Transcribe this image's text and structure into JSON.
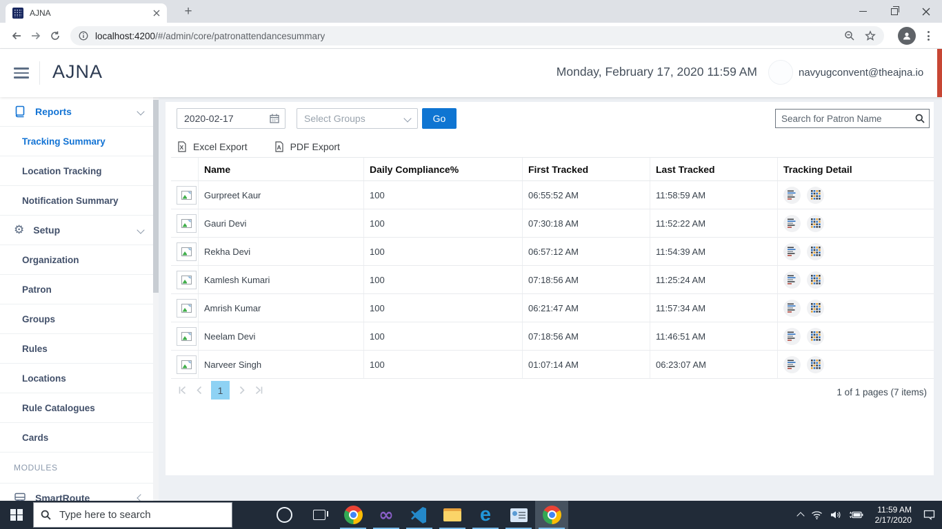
{
  "browser": {
    "tab": {
      "title": "AJNA"
    },
    "url_host": "localhost:4200",
    "url_path": "/#/admin/core/patronattendancesummary"
  },
  "header": {
    "app_title": "AJNA",
    "datetime": "Monday, February 17, 2020 11:59 AM",
    "user_email": "navyugconvent@theajna.io"
  },
  "sidebar": {
    "sections": [
      {
        "label": "Reports",
        "icon": "book-icon",
        "items": [
          "Tracking Summary",
          "Location Tracking",
          "Notification Summary"
        ]
      },
      {
        "label": "Setup",
        "icon": "gear-icon",
        "items": [
          "Organization",
          "Patron",
          "Groups",
          "Rules",
          "Locations",
          "Rule Catalogues",
          "Cards"
        ]
      }
    ],
    "active_item": "Tracking Summary",
    "modules_heading": "MODULES",
    "modules": [
      {
        "label": "SmartRoute",
        "icon": "bus-icon"
      }
    ]
  },
  "toolbar": {
    "date_value": "2020-02-17",
    "groups_placeholder": "Select Groups",
    "go_label": "Go",
    "search_placeholder": "Search for Patron Name"
  },
  "export": {
    "excel_label": "Excel Export",
    "pdf_label": "PDF Export"
  },
  "table": {
    "columns": {
      "name": "Name",
      "compliance": "Daily Compliance%",
      "first": "First Tracked",
      "last": "Last Tracked",
      "detail": "Tracking Detail"
    },
    "rows": [
      {
        "name": "Gurpreet Kaur",
        "compliance": "100",
        "first_tracked": "06:55:52 AM",
        "last_tracked": "11:58:59 AM"
      },
      {
        "name": "Gauri Devi",
        "compliance": "100",
        "first_tracked": "07:30:18 AM",
        "last_tracked": "11:52:22 AM"
      },
      {
        "name": "Rekha Devi",
        "compliance": "100",
        "first_tracked": "06:57:12 AM",
        "last_tracked": "11:54:39 AM"
      },
      {
        "name": "Kamlesh Kumari",
        "compliance": "100",
        "first_tracked": "07:18:56 AM",
        "last_tracked": "11:25:24 AM"
      },
      {
        "name": "Amrish Kumar",
        "compliance": "100",
        "first_tracked": "06:21:47 AM",
        "last_tracked": "11:57:34 AM"
      },
      {
        "name": "Neelam Devi",
        "compliance": "100",
        "first_tracked": "07:18:56 AM",
        "last_tracked": "11:46:51 AM"
      },
      {
        "name": "Narveer Singh",
        "compliance": "100",
        "first_tracked": "01:07:14 AM",
        "last_tracked": "06:23:07 AM"
      }
    ]
  },
  "pagination": {
    "page": "1",
    "info": "1 of 1 pages (7 items)"
  },
  "taskbar": {
    "search_placeholder": "Type here to search",
    "time": "11:59 AM",
    "date": "2/17/2020"
  },
  "colors": {
    "accent_blue": "#1273d4",
    "go_button_blue": "#0f75d2",
    "selected_page_blue": "#8ed2f4",
    "taskbar_bg": "#212b38",
    "header_edge_red": "#c74634"
  }
}
